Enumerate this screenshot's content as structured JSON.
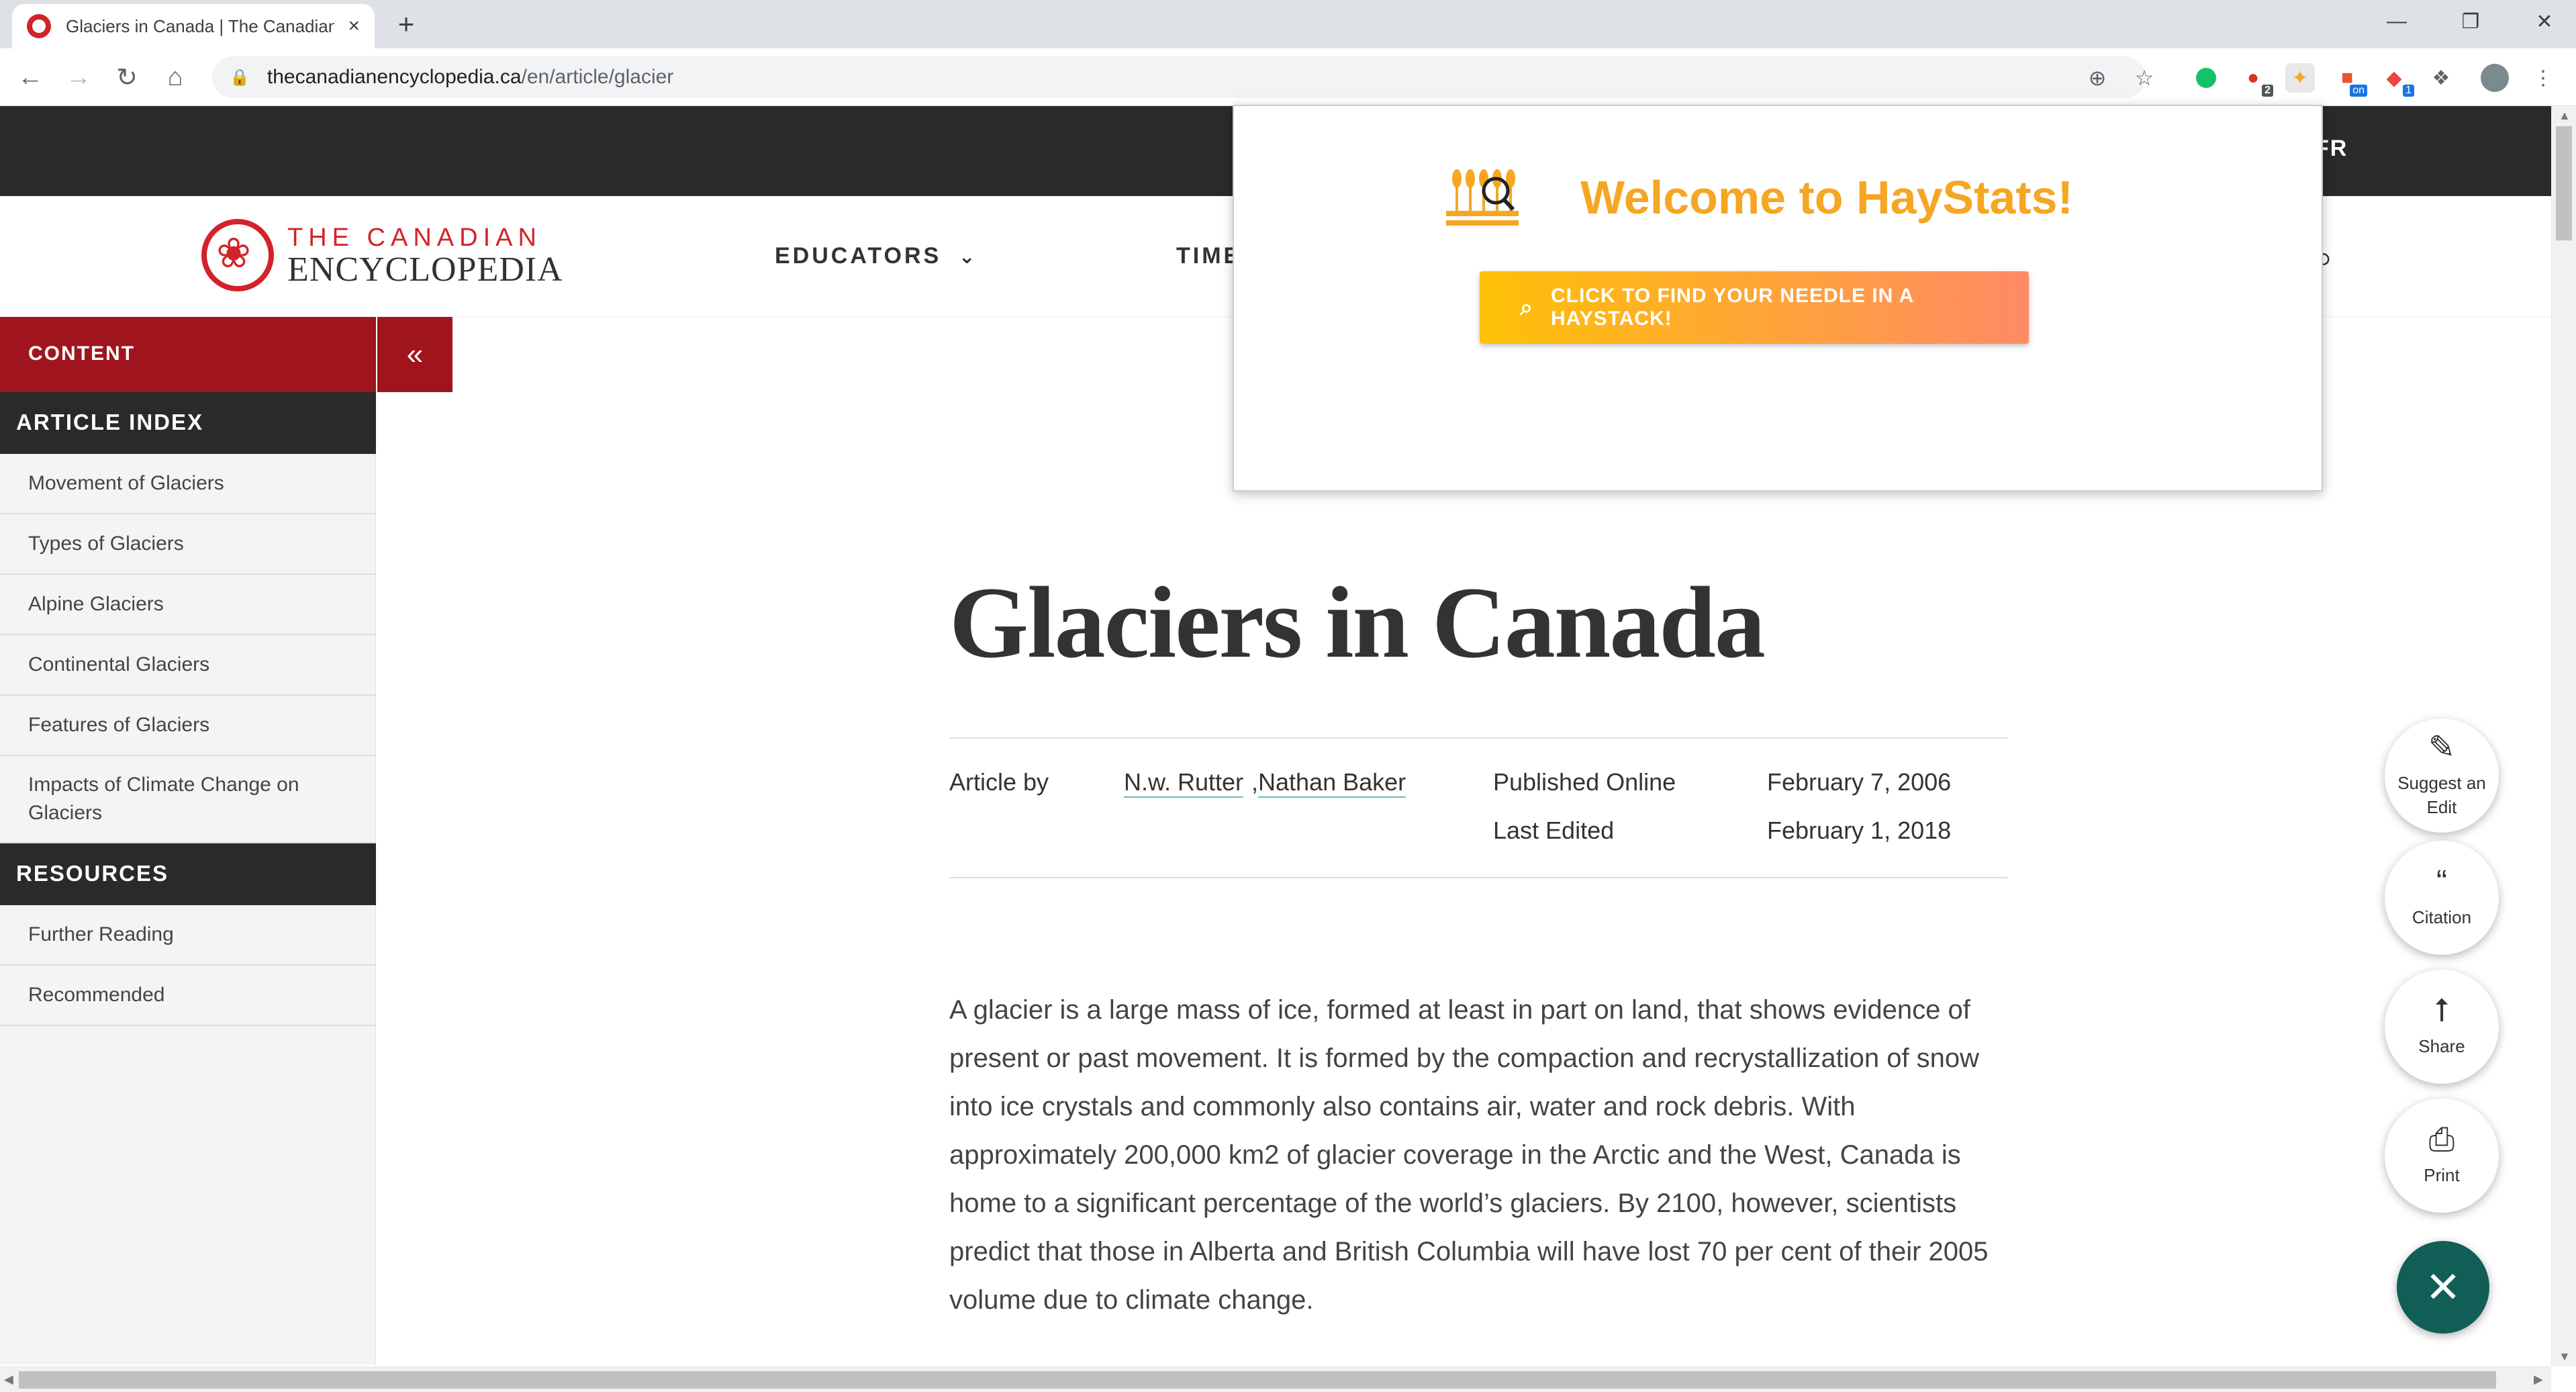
{
  "browser": {
    "tab_title": "Glaciers in Canada | The Canadian Encyclopedia",
    "tab_close": "×",
    "new_tab": "+",
    "url_host": "thecanadianencyclopedia.ca",
    "url_path": "/en/article/glacier",
    "extensions": [
      {
        "name": "grammarly-icon",
        "color": "#15c26b"
      },
      {
        "name": "adblock-icon",
        "badge": "2",
        "color": "#d93025"
      },
      {
        "name": "haystats-icon",
        "color": "#f5a623"
      },
      {
        "name": "extension-on-icon",
        "badge": "on",
        "color": "#e8542f"
      },
      {
        "name": "extension-badge-icon",
        "badge": "1",
        "color": "#e44"
      },
      {
        "name": "puzzle-icon"
      },
      {
        "name": "profile-avatar"
      }
    ]
  },
  "site": {
    "lang_toggle": "FR",
    "logo_line1": "THE CANADIAN",
    "logo_line2": "ENCYCLOPEDIA",
    "nav": [
      {
        "label": "EDUCATORS",
        "has_dropdown": true
      },
      {
        "label": "TIME"
      }
    ]
  },
  "sidebar": {
    "content_label": "CONTENT",
    "collapse_glyph": "«",
    "article_index_label": "ARTICLE INDEX",
    "article_index": [
      "Movement of Glaciers",
      "Types of Glaciers",
      "Alpine Glaciers",
      "Continental Glaciers",
      "Features of Glaciers",
      "Impacts of Climate Change on Glaciers"
    ],
    "resources_label": "RESOURCES",
    "resources": [
      "Further Reading",
      "Recommended"
    ]
  },
  "article": {
    "title": "Glaciers in Canada",
    "article_by_label": "Article by",
    "authors": [
      "N.w. Rutter",
      "Nathan Baker"
    ],
    "author_separator": ",",
    "published_label": "Published Online",
    "published_date": "February 7, 2006",
    "edited_label": "Last Edited",
    "edited_date": "February 1, 2018",
    "body": "A glacier is a large mass of ice, formed at least in part on land, that shows evidence of present or past movement. It is formed by the compaction and recrystallization of snow into ice crystals and commonly also contains air, water and rock debris. With approximately 200,000 km2 of glacier coverage in the Arctic and the West, Canada is home to a significant percentage of the world’s glaciers. By 2100, however, scientists predict that those in Alberta and British Columbia will have lost 70 per cent of their 2005 volume due to climate change."
  },
  "floating_actions": [
    {
      "label": "Suggest an Edit",
      "icon": "edit-icon"
    },
    {
      "label": "Citation",
      "icon": "quote-icon"
    },
    {
      "label": "Share",
      "icon": "share-icon"
    },
    {
      "label": "Print",
      "icon": "print-icon"
    }
  ],
  "popup": {
    "title": "Welcome to HayStats!",
    "cta_label": "CLICK TO FIND YOUR NEEDLE IN A HAYSTACK!",
    "accent_color": "#f5a623"
  },
  "colors": {
    "brand_red": "#d2232a",
    "sidebar_red": "#a0151d",
    "dark_bar": "#2a2a2a",
    "fab_close": "#115e57"
  }
}
